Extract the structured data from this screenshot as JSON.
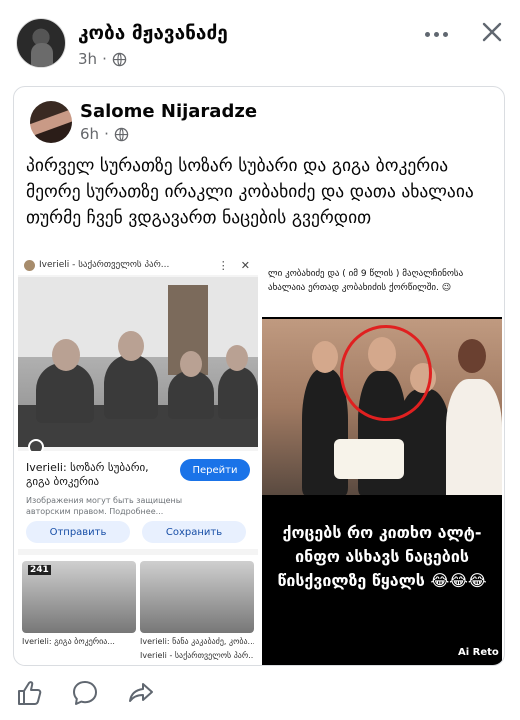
{
  "post": {
    "author": "კობა მჟავანაძე",
    "time": "3h",
    "separator": "·"
  },
  "shared": {
    "author": "Salome Nijaradze",
    "time": "6h",
    "separator": "·",
    "text": "პირველ სურათზე სოზარ სუბარი და გიგა ბოკერია მეორე სურათზე ირაკლი კობახიძე და დათა ახალაია თურმე ჩვენ ვდგავართ ნაცების გვერდით"
  },
  "left_shot": {
    "source_bar": "Iverieli - საქართველოს პარ...",
    "title": "Iverieli: სოზარ სუბარი, გიგა ბოკერია",
    "visit_label": "Перейти",
    "copyright": "Изображения могут быть защищены авторским правом. Подробнее...",
    "send_label": "Отправить",
    "save_label": "Сохранить",
    "thumb_logo": "241",
    "thumb_caption_1": "Iverieli: გიგა ბოკერია...",
    "thumb_caption_2": "Iverieli: ნანა კაკაბაძე, კობა...",
    "thumb_caption_3": "Iverieli - საქართველოს პარ..."
  },
  "right_shot": {
    "caption": "ლი კობახიძე და ( იმ 9 წლის ) მაღალჩინოსა ახალაია ერთად კობახიძის ქორწილში. 😉",
    "meme_text": "ქოცებს რო კითხო ალტ-ინფო ასხავს ნაცების წისქვილზე წყალს 😂😂😂",
    "watermark": "Ai Reto",
    "circle_color": "#e02020"
  },
  "icons": {
    "more": "more-icon",
    "close": "close-icon",
    "globe": "globe-icon",
    "like": "like-icon",
    "comment": "comment-icon",
    "share": "share-icon"
  }
}
